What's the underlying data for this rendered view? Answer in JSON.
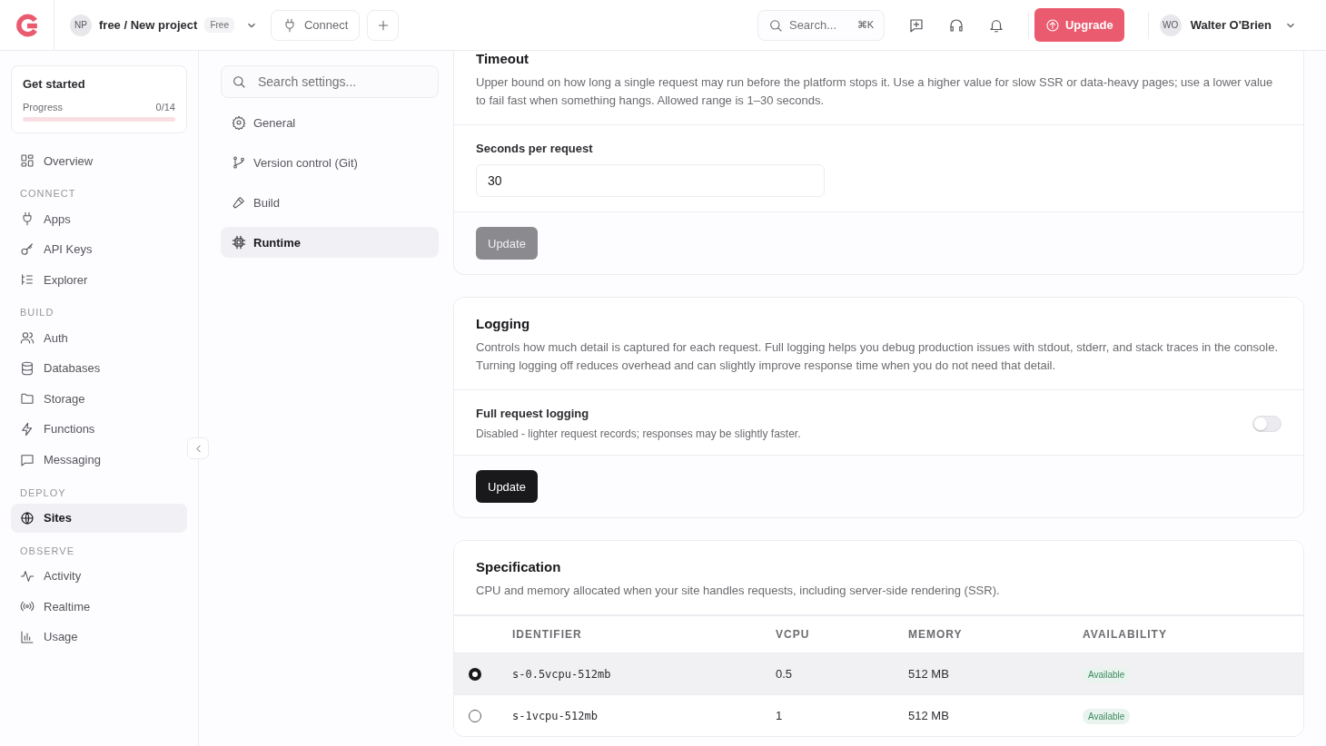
{
  "header": {
    "project": {
      "avatar": "NP",
      "name": "free / New project",
      "plan": "Free"
    },
    "connect": "Connect",
    "search": {
      "placeholder": "Search...",
      "shortcut": "⌘K"
    },
    "upgrade": "Upgrade",
    "user": {
      "avatar": "WO",
      "name": "Walter O'Brien"
    }
  },
  "sidebar": {
    "get_started": {
      "title": "Get started",
      "progress_label": "Progress",
      "count": "0/14",
      "level": 0
    },
    "sections": [
      {
        "items": [
          {
            "label": "Overview",
            "selected": false
          }
        ]
      },
      {
        "heading": "CONNECT",
        "items": [
          {
            "label": "Apps",
            "selected": false
          },
          {
            "label": "API Keys",
            "selected": false
          },
          {
            "label": "Explorer",
            "selected": false
          }
        ]
      },
      {
        "heading": "BUILD",
        "items": [
          {
            "label": "Auth",
            "selected": false
          },
          {
            "label": "Databases",
            "selected": false
          },
          {
            "label": "Storage",
            "selected": false
          },
          {
            "label": "Functions",
            "selected": false
          },
          {
            "label": "Messaging",
            "selected": false
          }
        ]
      },
      {
        "heading": "DEPLOY",
        "items": [
          {
            "label": "Sites",
            "selected": true
          }
        ]
      },
      {
        "heading": "OBSERVE",
        "items": [
          {
            "label": "Activity",
            "selected": false
          },
          {
            "label": "Realtime",
            "selected": false
          },
          {
            "label": "Usage",
            "selected": false
          }
        ]
      }
    ]
  },
  "settings_nav": {
    "search": {
      "placeholder": "Search settings..."
    },
    "items": [
      {
        "label": "General",
        "selected": false
      },
      {
        "label": "Version control (Git)",
        "selected": false
      },
      {
        "label": "Build",
        "selected": false
      },
      {
        "label": "Runtime",
        "selected": true
      }
    ]
  },
  "timeout": {
    "title": "Timeout",
    "description": "Upper bound on how long a single request may run before the platform stops it. Use a higher value for slow SSR or data-heavy pages; use a lower value to fail fast when something hangs. Allowed range is 1–30 seconds.",
    "field_label": "Seconds per request",
    "value": "30",
    "button": {
      "label": "Update",
      "disabled": true
    }
  },
  "logging": {
    "title": "Logging",
    "description": "Controls how much detail is captured for each request. Full logging helps you debug production issues with stdout, stderr, and stack traces in the console. Turning logging off reduces overhead and can slightly improve response time when you do not need that detail.",
    "setting_label": "Full request logging",
    "setting_hint": "Disabled - lighter request records; responses may be slightly faster.",
    "on": false,
    "button": {
      "label": "Update",
      "disabled": false
    }
  },
  "specification": {
    "title": "Specification",
    "description": "CPU and memory allocated when your site handles requests, including server-side rendering (SSR).",
    "columns": [
      "IDENTIFIER",
      "VCPU",
      "MEMORY",
      "AVAILABILITY"
    ],
    "rows": [
      {
        "selected": true,
        "identifier": "s-0.5vcpu-512mb",
        "vcpu": "0.5",
        "memory": "512 MB",
        "availability": "Available"
      },
      {
        "selected": false,
        "identifier": "s-1vcpu-512mb",
        "vcpu": "1",
        "memory": "512 MB",
        "availability": "Available"
      }
    ]
  }
}
